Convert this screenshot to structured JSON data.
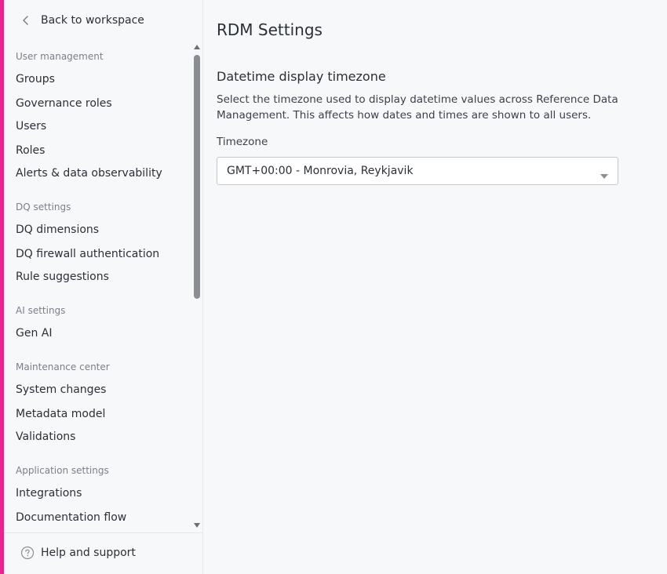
{
  "sidebar": {
    "back_label": "Back to workspace",
    "sections": [
      {
        "title": "User management",
        "items": [
          "Groups",
          "Governance roles",
          "Users",
          "Roles",
          "Alerts & data observability"
        ]
      },
      {
        "title": "DQ settings",
        "items": [
          "DQ dimensions",
          "DQ firewall authentication",
          "Rule suggestions"
        ]
      },
      {
        "title": "AI settings",
        "items": [
          "Gen AI"
        ]
      },
      {
        "title": "Maintenance center",
        "items": [
          "System changes",
          "Metadata model",
          "Validations"
        ]
      },
      {
        "title": "Application settings",
        "items": [
          "Integrations",
          "Documentation flow"
        ]
      }
    ],
    "help_label": "Help and support"
  },
  "main": {
    "page_title": "RDM Settings",
    "section_title": "Datetime display timezone",
    "section_description": "Select the timezone used to display datetime values across Reference Data Management. This affects how dates and times are shown to all users.",
    "timezone_label": "Timezone",
    "timezone_value": "GMT+00:00 - Monrovia, Reykjavik"
  },
  "colors": {
    "accent": "#e8258f",
    "background": "#f7f8fa",
    "text": "#2b2f36",
    "muted": "#7a8089"
  }
}
